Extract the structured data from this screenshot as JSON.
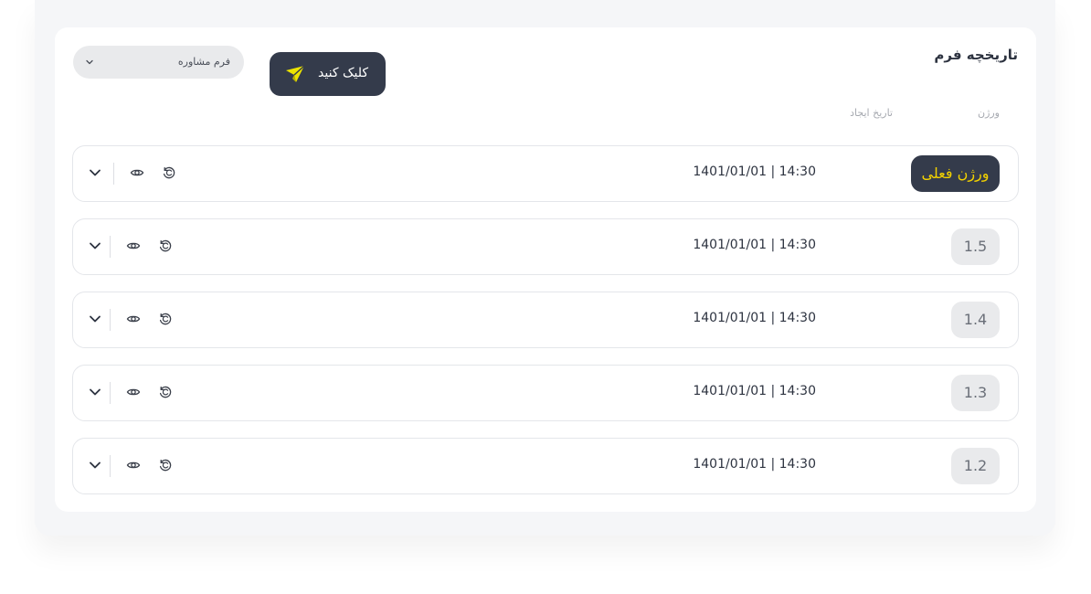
{
  "header": {
    "title": "تاریخچه فرم",
    "select_value": "فرم مشاوره",
    "cta_label": "کلیک کنید"
  },
  "columns": {
    "version": "ورژن",
    "created": "تاریخ ایجاد"
  },
  "rows": [
    {
      "version": "ورژن فعلی",
      "date": "1401/01/01 | 14:30",
      "current": true
    },
    {
      "version": "1.5",
      "date": "1401/01/01 | 14:30",
      "current": false
    },
    {
      "version": "1.4",
      "date": "1401/01/01 | 14:30",
      "current": false
    },
    {
      "version": "1.3",
      "date": "1401/01/01 | 14:30",
      "current": false
    },
    {
      "version": "1.2",
      "date": "1401/01/01 | 14:30",
      "current": false
    }
  ],
  "icons": {
    "select": "chevron-down-icon",
    "cta": "paper-plane-icon",
    "row_actions": [
      "restore-icon",
      "eye-icon",
      "chevron-down-icon"
    ]
  },
  "colors": {
    "dark": "#343b4b",
    "accent": "#f2d100",
    "badge_gray": "#e9eaec",
    "plane_yellow": "#ece300"
  }
}
